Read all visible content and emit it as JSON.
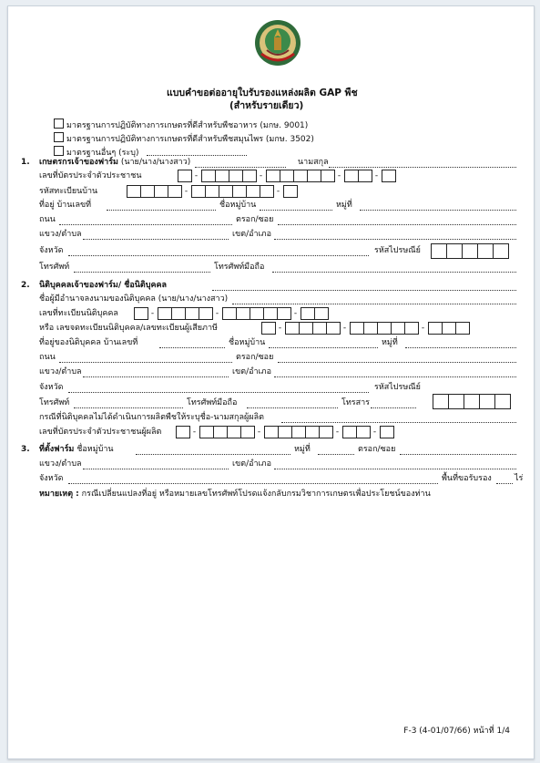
{
  "title": "แบบคำขอต่ออายุใบรับรองแหล่งผลิต GAP พืช",
  "subtitle": "(สำหรับรายเดียว)",
  "logo_text": "กรมวิชาการเกษตร",
  "standards": [
    "มาตรฐานการปฏิบัติทางการเกษตรที่ดีสำหรับพืชอาหาร (มกษ. 9001)",
    "มาตรฐานการปฏิบัติทางการเกษตรที่ดีสำหรับพืชสมุนไพร (มกษ. 3502)",
    "มาตรฐานอื่นๆ (ระบุ)"
  ],
  "s1": {
    "num": "1.",
    "head": "เกษตรกรเจ้าของฟาร์ม",
    "head_suffix": "(นาย/นาง/นางสาว)",
    "surname": "นามสกุล",
    "id_card": "เลขที่บัตรประจำตัวประชาชน",
    "house_reg": "รหัสทะเบียนบ้าน",
    "address": "ที่อยู่  บ้านเลขที่",
    "village": "ชื่อหมู่บ้าน",
    "moo": "หมู่ที่",
    "road": "ถนน",
    "soi": "ตรอก/ซอย",
    "subdistrict": "แขวง/ตำบล",
    "district": "เขต/อำเภอ",
    "province": "จังหวัด",
    "postcode": "รหัสไปรษณีย์",
    "phone": "โทรศัพท์",
    "mobile": "โทรศัพท์มือถือ"
  },
  "s2": {
    "num": "2.",
    "head": "นิติบุคคลเจ้าของฟาร์ม/ ชื่อนิติบุคคล",
    "authorized": "ชื่อผู้มีอำนาจลงนามของนิติบุคคล (นาย/นาง/นางสาว)",
    "juristic_id": "เลขที่ทะเบียนนิติบุคคล",
    "or_tax": "หรือ เลขจดทะเบียนนิติบุคคล/เลขทะเบียนผู้เสียภาษี",
    "address": "ที่อยู่ของนิติบุคคล บ้านเลขที่",
    "village": "ชื่อหมู่บ้าน",
    "moo": "หมู่ที่",
    "road": "ถนน",
    "soi": "ตรอก/ซอย",
    "subdistrict": "แขวง/ตำบล",
    "district": "เขต/อำเภอ",
    "province": "จังหวัด",
    "postcode": "รหัสไปรษณีย์",
    "phone": "โทรศัพท์",
    "mobile": "โทรศัพท์มือถือ",
    "fax": "โทรสาร",
    "producer": "กรณีที่นิติบุคคลไม่ได้ดำเนินการผลิตพืชให้ระบุชื่อ-นามสกุลผู้ผลิต",
    "producer_id": "เลขที่บัตรประจำตัวประชาชนผู้ผลิต"
  },
  "s3": {
    "num": "3.",
    "head": "ที่ตั้งฟาร์ม",
    "village": "ชื่อหมู่บ้าน",
    "moo": "หมู่ที่",
    "soi": "ตรอก/ซอย",
    "subdistrict": "แขวง/ตำบล",
    "district": "เขต/อำเภอ",
    "province": "จังหวัด",
    "area": "พื้นที่ขอรับรอง",
    "rai": "ไร่"
  },
  "note_label": "หมายเหตุ :",
  "note_text": "กรณีเปลี่ยนแปลงที่อยู่ หรือหมายเลขโทรศัพท์โปรดแจ้งกลับกรมวิชาการเกษตรเพื่อประโยชน์ของท่าน",
  "footer": "F-3 (4-01/07/66) หน้าที่ 1/4"
}
